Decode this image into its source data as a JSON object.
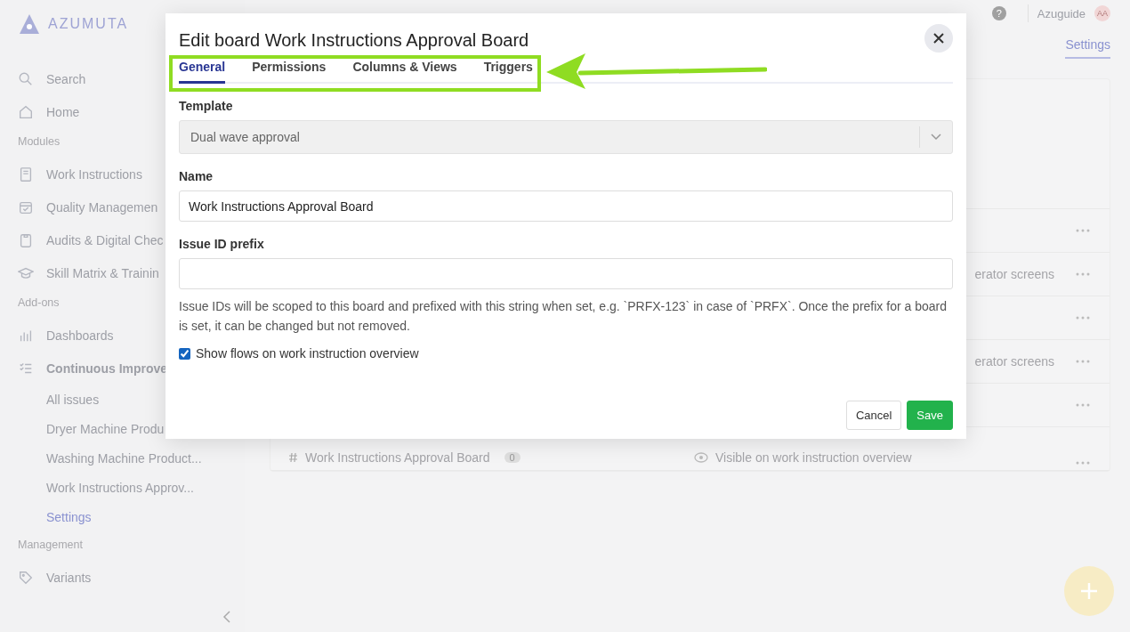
{
  "sidebar": {
    "logo": "AZUMUTA",
    "items": [
      {
        "kind": "item",
        "label": "Search",
        "selected": false
      },
      {
        "kind": "item",
        "label": "Home",
        "selected": false
      },
      {
        "kind": "section",
        "label": "Modules"
      },
      {
        "kind": "item",
        "label": "Work Instructions",
        "selected": false
      },
      {
        "kind": "item",
        "label": "Quality Managemen",
        "selected": false
      },
      {
        "kind": "item",
        "label": "Audits & Digital Chec",
        "selected": false
      },
      {
        "kind": "item",
        "label": "Skill Matrix & Trainin",
        "selected": false
      },
      {
        "kind": "section",
        "label": "Add-ons"
      },
      {
        "kind": "item",
        "label": "Dashboards",
        "selected": false
      },
      {
        "kind": "item",
        "label": "Continuous Improve",
        "selected": false,
        "bold": true
      },
      {
        "kind": "sub",
        "label": "All issues",
        "selected": false
      },
      {
        "kind": "sub",
        "label": "Dryer Machine Produ",
        "selected": false
      },
      {
        "kind": "sub",
        "label": "Washing Machine Product...",
        "selected": false
      },
      {
        "kind": "sub",
        "label": "Work Instructions Approv...",
        "selected": false
      },
      {
        "kind": "sub",
        "label": "Settings",
        "selected": true
      },
      {
        "kind": "section",
        "label": "Management"
      },
      {
        "kind": "item",
        "label": "Variants",
        "selected": false
      }
    ]
  },
  "header": {
    "help": "?",
    "user": "Azuguide",
    "avatar": "AA"
  },
  "page_tabs": [
    {
      "label": "Settings",
      "selected": true
    }
  ],
  "rows": [
    {},
    {
      "right": "erator screens"
    },
    {},
    {
      "right": "erator screens"
    },
    {},
    {
      "left": "Work Instructions Approval Board",
      "count": "0",
      "right": "Visible on work instruction overview"
    }
  ],
  "dialog": {
    "title": "Edit board Work Instructions Approval Board",
    "tabs": [
      {
        "label": "General",
        "selected": true
      },
      {
        "label": "Permissions",
        "selected": false
      },
      {
        "label": "Columns & Views",
        "selected": false
      },
      {
        "label": "Triggers",
        "selected": false
      }
    ],
    "template": {
      "label": "Template",
      "value": "Dual wave approval",
      "disabled": true
    },
    "name": {
      "label": "Name",
      "value": "Work Instructions Approval Board"
    },
    "prefix": {
      "label": "Issue ID prefix",
      "help": "Issue IDs will be scoped to this board and prefixed with this string when set, e.g. `PRFX-123` in case of `PRFX`. Once the prefix for a board is set, it can be changed but not removed."
    },
    "show_flows": {
      "label": "Show flows on work instruction overview",
      "checked": true
    },
    "buttons": [
      {
        "label": "Cancel",
        "kind": "secondary"
      },
      {
        "label": "Save",
        "kind": "primary"
      }
    ]
  }
}
